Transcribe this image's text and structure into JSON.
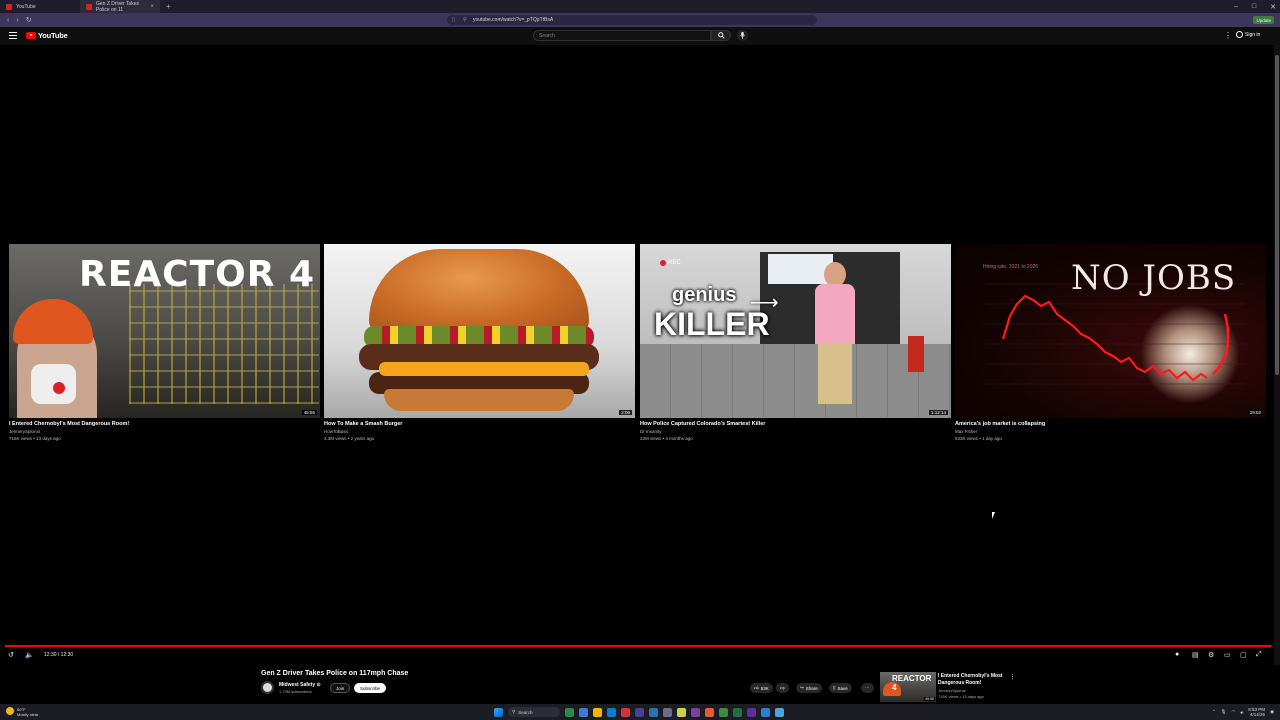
{
  "browser": {
    "tabs": [
      {
        "label": "YouTube"
      },
      {
        "label": "Gen Z Driver Takes Police on 11"
      }
    ],
    "url": "youtube.com/watch?v=_pTQpTtBsA",
    "update_label": "Update"
  },
  "header": {
    "logo_text": "YouTube",
    "search_placeholder": "Search",
    "signin_label": "Sign in"
  },
  "endscreen": {
    "cards": [
      {
        "title": "I Entered Chernobyl's Most Dangerous Room!",
        "channel": "JennerySploros",
        "meta": "716K views • 13 days ago",
        "duration": "45:55",
        "thumb_text": "REACTOR 4"
      },
      {
        "title": "How To Make a Smash Burger",
        "channel": "HowToBasic",
        "meta": "3.3M views • 2 years ago",
        "duration": "2:06",
        "thumb_text": ""
      },
      {
        "title": "How Police Captured Colorado's Smartest Killer",
        "channel": "Dr Insanity",
        "meta": "22M views • 4 months ago",
        "duration": "1:12:14",
        "thumb_text_1": "genius",
        "thumb_text_2": "KILLER",
        "rec_label": "REC"
      },
      {
        "title": "America's job market is collapsing",
        "channel": "Max Fisher",
        "meta": "633K views • 1 day ago",
        "duration": "29:02",
        "thumb_text": "NO JOBS",
        "chart_title": "Hiring rate, 2021 to 2026"
      }
    ]
  },
  "player": {
    "time": "12:30 / 12:30",
    "progress": 1.0
  },
  "video": {
    "title": "Gen Z Driver Takes Police on 117mph Chase",
    "channel_name": "Midwest Safety ⊙",
    "subscribers": "1.73M subscribers",
    "join_label": "Join",
    "subscribe_label": "Subscribe",
    "likes": "53K",
    "share_label": "Share",
    "save_label": "Save"
  },
  "up_next": {
    "title": "I Entered Chernobyl's Most Dangerous Room!",
    "channel": "JennerySploros",
    "meta": "716K views • 13 days ago",
    "thumb_text": "REACTOR 4",
    "duration": "45:55"
  },
  "taskbar": {
    "weather_temp": "50°F",
    "weather_desc": "Mostly clear",
    "search_label": "Search",
    "time": "8:53 PM",
    "date": "4/14/26"
  },
  "colors": {
    "accent": "#ff0000",
    "browser_bar": "#3b365a"
  }
}
